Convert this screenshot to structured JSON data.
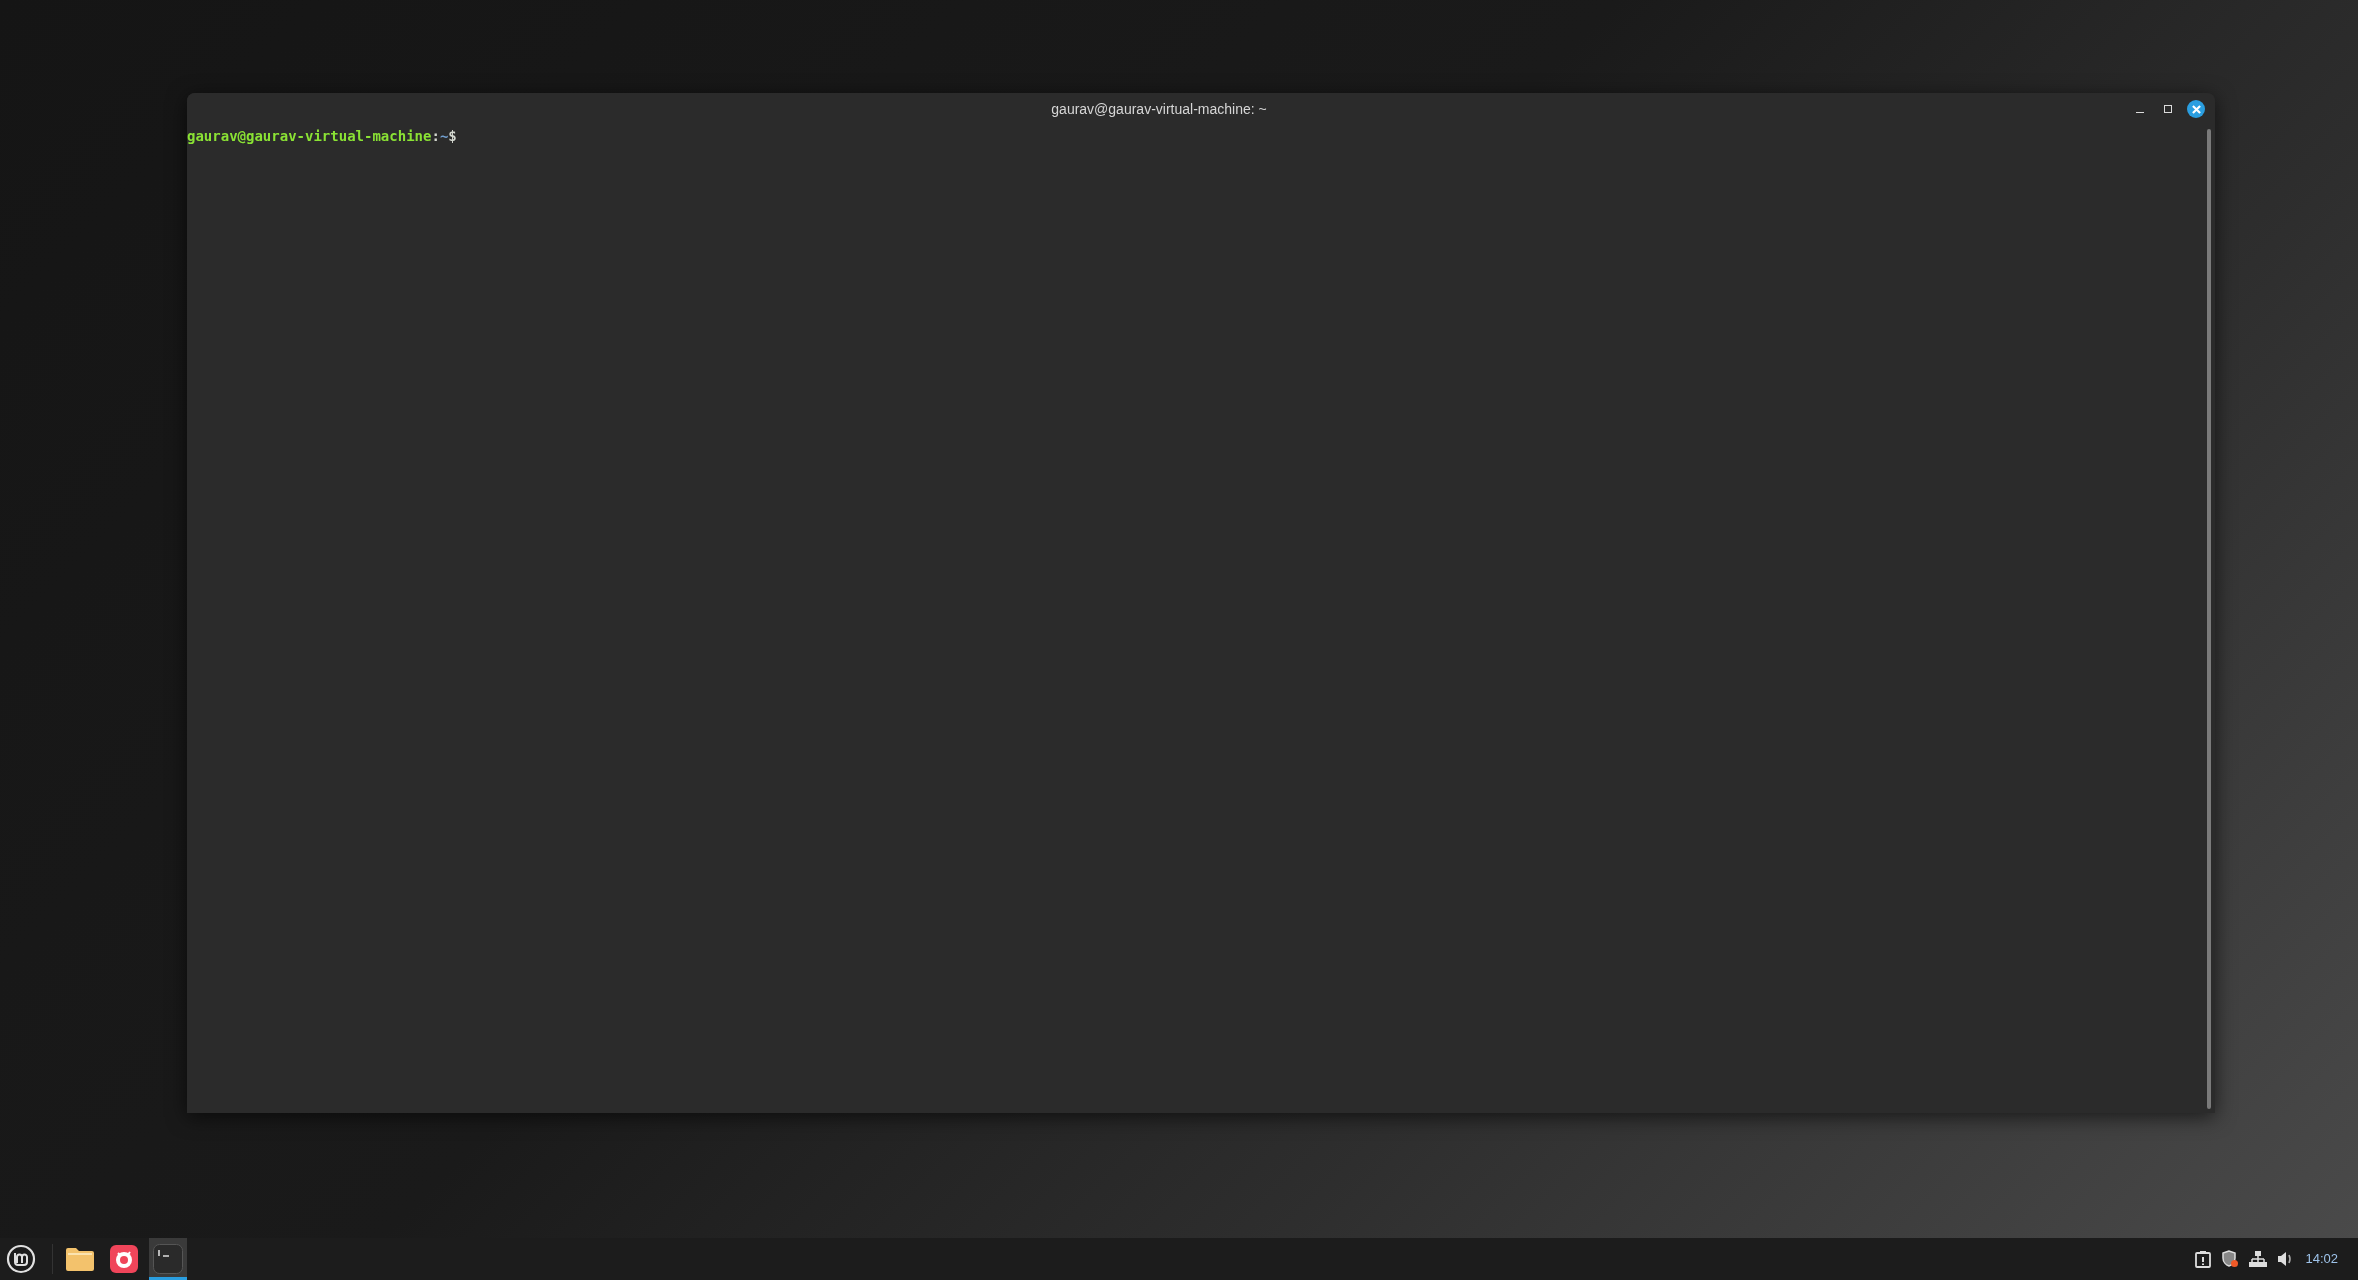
{
  "window": {
    "title": "gaurav@gaurav-virtual-machine: ~"
  },
  "terminal": {
    "prompt_user": "gaurav@gaurav-virtual-machine",
    "prompt_colon": ":",
    "prompt_path": "~",
    "prompt_symbol": "$"
  },
  "taskbar": {
    "apps": [
      {
        "kind": "files",
        "active": false
      },
      {
        "kind": "browser",
        "active": false
      },
      {
        "kind": "terminal",
        "active": true
      }
    ],
    "tray": [
      {
        "kind": "clipboard"
      },
      {
        "kind": "shield"
      },
      {
        "kind": "network"
      },
      {
        "kind": "volume"
      }
    ],
    "clock": "14:02"
  }
}
